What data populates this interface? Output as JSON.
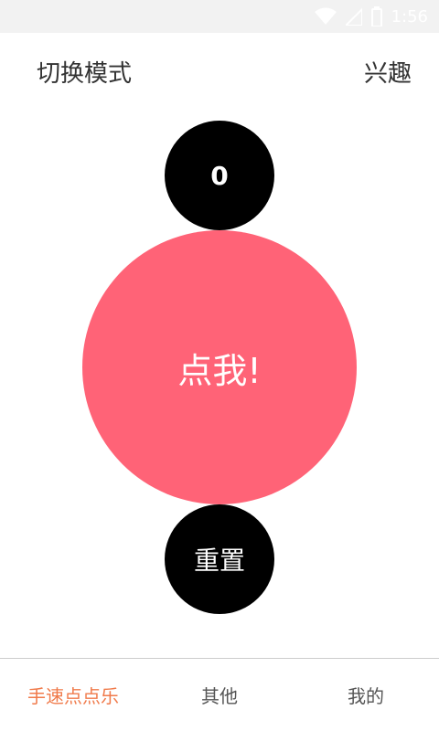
{
  "status_bar": {
    "time": "1:56",
    "icons": [
      "wifi-icon",
      "signal-icon",
      "battery-icon"
    ]
  },
  "top_bar": {
    "left_label": "切换模式",
    "right_label": "兴趣"
  },
  "main": {
    "count": "0",
    "tap_label": "点我!",
    "reset_label": "重置"
  },
  "bottom_nav": {
    "items": [
      {
        "label": "手速点点乐",
        "active": true
      },
      {
        "label": "其他",
        "active": false
      },
      {
        "label": "我的",
        "active": false
      }
    ]
  },
  "colors": {
    "tap_circle": "#ff6377",
    "active_tab": "#f07a4a",
    "black_circle": "#000000"
  }
}
